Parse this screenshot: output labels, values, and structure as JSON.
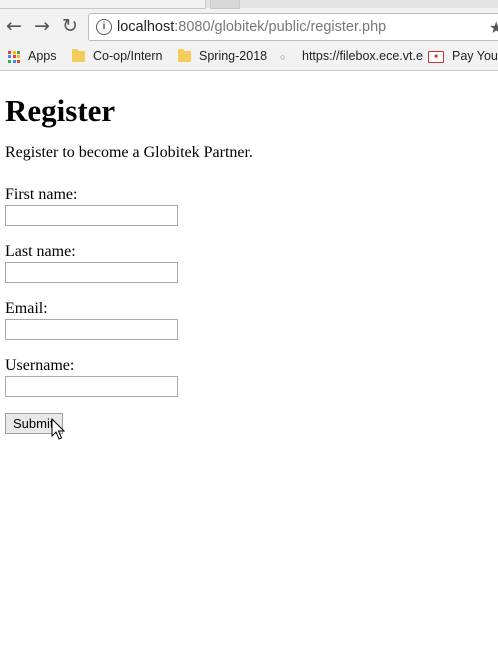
{
  "browser": {
    "url_host": "localhost",
    "url_rest": ":8080/globitek/public/register.php",
    "bookmarks": [
      {
        "label": "Apps",
        "icon": "apps-grid-icon"
      },
      {
        "label": "Co-op/Intern",
        "icon": "folder-icon"
      },
      {
        "label": "Spring-2018",
        "icon": "folder-icon"
      },
      {
        "label": "https://filebox.ece.vt.e",
        "icon": "page-icon"
      },
      {
        "label": "Pay Your",
        "icon": "payment-icon"
      }
    ]
  },
  "page": {
    "title": "Register",
    "intro": "Register to become a Globitek Partner.",
    "fields": [
      {
        "label": "First name:",
        "value": ""
      },
      {
        "label": "Last name:",
        "value": ""
      },
      {
        "label": "Email:",
        "value": ""
      },
      {
        "label": "Username:",
        "value": ""
      }
    ],
    "submit_label": "Submit"
  }
}
